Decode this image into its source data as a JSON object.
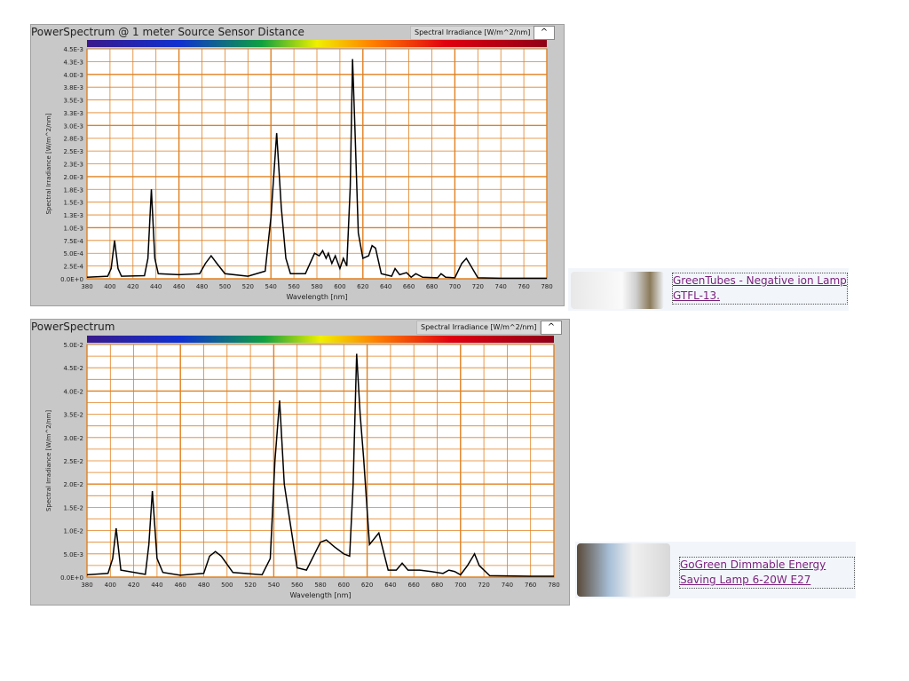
{
  "chart_data": [
    {
      "type": "line",
      "title": "PowerSpectrum @ 1 meter Source Sensor Distance",
      "legend": "Spectral Irradiance [W/m^2/nm]",
      "xlabel": "Wavelength [nm]",
      "ylabel": "Spectral Irradiance [W/m^2/nm]",
      "xlim": [
        380,
        780
      ],
      "ylim": [
        0,
        0.0045
      ],
      "xticks": [
        "380",
        "400",
        "420",
        "440",
        "460",
        "480",
        "500",
        "520",
        "540",
        "560",
        "580",
        "600",
        "620",
        "640",
        "660",
        "680",
        "700",
        "720",
        "740",
        "760",
        "780"
      ],
      "yticks": [
        "0.0E+0",
        "2.5E-4",
        "5.0E-4",
        "7.5E-4",
        "1.0E-3",
        "1.3E-3",
        "1.5E-3",
        "1.8E-3",
        "2.0E-3",
        "2.3E-3",
        "2.5E-3",
        "2.8E-3",
        "3.0E-3",
        "3.3E-3",
        "3.5E-3",
        "3.8E-3",
        "4.0E-3",
        "4.3E-3",
        "4.5E-3"
      ],
      "x": [
        380,
        398,
        401,
        404,
        407,
        410,
        430,
        433,
        436,
        439,
        442,
        460,
        478,
        483,
        488,
        493,
        500,
        520,
        535,
        540,
        545,
        549,
        553,
        557,
        570,
        575,
        578,
        582,
        585,
        588,
        590,
        593,
        596,
        600,
        603,
        606,
        609,
        611,
        613,
        616,
        620,
        625,
        628,
        631,
        636,
        645,
        648,
        652,
        658,
        662,
        666,
        672,
        685,
        688,
        692,
        700,
        706,
        710,
        714,
        720,
        740,
        780
      ],
      "y": [
        3e-05,
        5e-05,
        0.0002,
        0.00075,
        0.0002,
        5e-05,
        6e-05,
        0.0004,
        0.00175,
        0.0004,
        0.0001,
        8e-05,
        0.0001,
        0.0003,
        0.00045,
        0.0003,
        0.0001,
        5e-05,
        0.00015,
        0.0012,
        0.00285,
        0.0014,
        0.0004,
        0.0001,
        0.0001,
        0.00035,
        0.0005,
        0.00045,
        0.00055,
        0.0004,
        0.0005,
        0.0003,
        0.00045,
        0.0002,
        0.0004,
        0.00025,
        0.0018,
        0.0043,
        0.003,
        0.0009,
        0.0004,
        0.00045,
        0.00065,
        0.0006,
        0.0001,
        5e-05,
        0.0002,
        8e-05,
        0.00012,
        3e-05,
        0.0001,
        3e-05,
        2e-05,
        0.0001,
        3e-05,
        2e-05,
        0.0003,
        0.0004,
        0.00025,
        2e-05,
        1e-05,
        1e-05
      ]
    },
    {
      "type": "line",
      "title": "PowerSpectrum",
      "legend": "Spectral Irradiance [W/m^2/nm]",
      "xlabel": "Wavelength [nm]",
      "ylabel": "Spectral Irradiance [W/m^2/nm]",
      "xlim": [
        380,
        780
      ],
      "ylim": [
        0,
        0.05
      ],
      "xticks": [
        "380",
        "400",
        "420",
        "440",
        "460",
        "480",
        "500",
        "520",
        "540",
        "560",
        "580",
        "600",
        "620",
        "640",
        "660",
        "680",
        "700",
        "720",
        "740",
        "760",
        "780"
      ],
      "yticks": [
        "0.0E+0",
        "5.0E-3",
        "1.0E-2",
        "1.5E-2",
        "2.0E-2",
        "2.5E-2",
        "3.0E-2",
        "3.5E-2",
        "4.0E-2",
        "4.5E-2",
        "5.0E-2"
      ],
      "x": [
        380,
        398,
        402,
        405,
        409,
        430,
        433,
        436,
        440,
        445,
        460,
        480,
        485,
        490,
        495,
        505,
        530,
        537,
        541,
        545,
        549,
        552,
        560,
        568,
        575,
        580,
        585,
        592,
        600,
        605,
        608,
        611,
        614,
        617,
        622,
        630,
        638,
        645,
        650,
        655,
        665,
        675,
        685,
        690,
        695,
        700,
        706,
        712,
        716,
        725,
        760,
        780
      ],
      "y": [
        0.0005,
        0.0008,
        0.004,
        0.0105,
        0.0015,
        0.0006,
        0.007,
        0.0185,
        0.004,
        0.001,
        0.0004,
        0.0008,
        0.0045,
        0.0055,
        0.0045,
        0.001,
        0.0005,
        0.004,
        0.025,
        0.038,
        0.02,
        0.015,
        0.002,
        0.0015,
        0.005,
        0.0075,
        0.008,
        0.0065,
        0.005,
        0.0045,
        0.02,
        0.048,
        0.035,
        0.0255,
        0.007,
        0.0095,
        0.0015,
        0.0015,
        0.003,
        0.0015,
        0.0015,
        0.0012,
        0.0008,
        0.0015,
        0.0012,
        0.0005,
        0.0025,
        0.005,
        0.0025,
        0.0003,
        0.0002,
        0.0002
      ]
    }
  ],
  "lamps": [
    {
      "name": "GreenTubes - Negative ion Lamp GTFL-13."
    },
    {
      "name": "GoGreen Dimmable Energy Saving Lamp 6-20W E27"
    }
  ]
}
